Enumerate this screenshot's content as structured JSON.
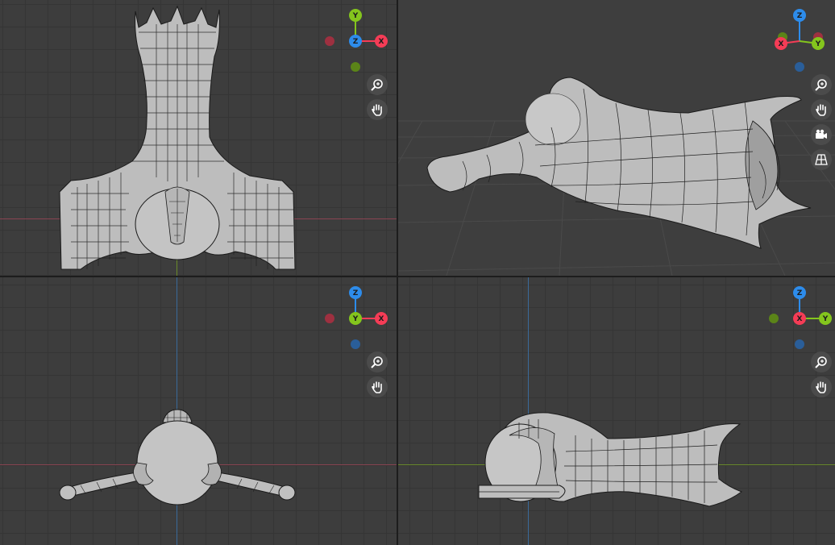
{
  "viewports": {
    "top": {
      "gizmo": {
        "up": "Y",
        "center": "Z",
        "right": "X"
      }
    },
    "perspective": {
      "gizmo": {
        "up": "Z",
        "left": "X",
        "right": "Y"
      }
    },
    "front": {
      "gizmo": {
        "up": "Z",
        "center": "Y",
        "right": "X"
      }
    },
    "right": {
      "gizmo": {
        "up": "Z",
        "center": "X",
        "right": "Y"
      }
    }
  },
  "icons": [
    "zoom-icon",
    "pan-hand-icon",
    "camera-icon",
    "perspective-grid-icon"
  ],
  "colors": {
    "viewport_bg": "#3d3d3d",
    "grid_line": "#353535",
    "axis_x": "#f53c56",
    "axis_y": "#84c51d",
    "axis_z": "#2d8ceb",
    "mesh_fill": "#bdbdbd",
    "wire": "#1a1a1a"
  }
}
